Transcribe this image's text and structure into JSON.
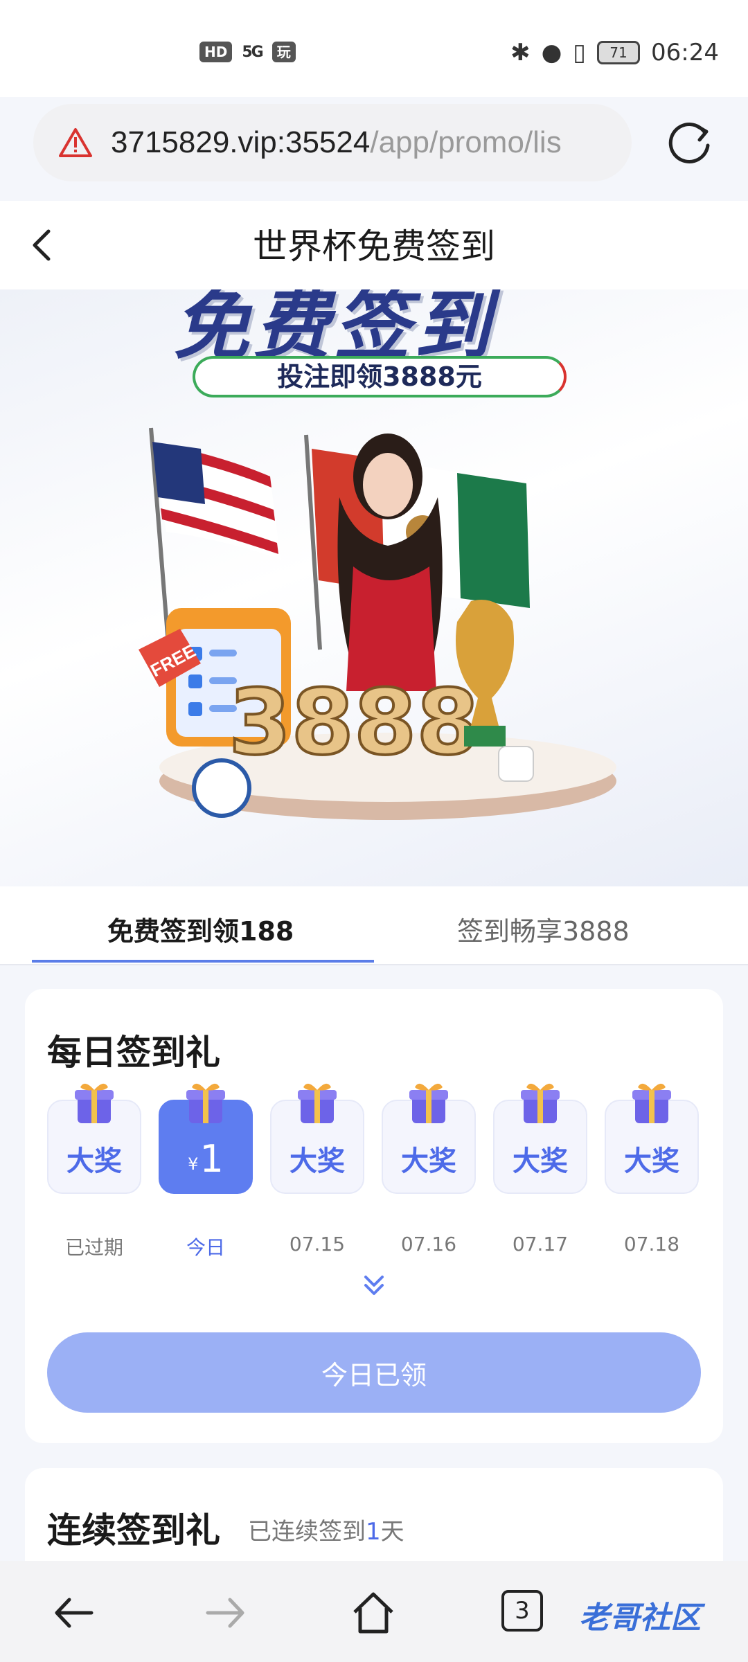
{
  "status_bar": {
    "hd": "HD",
    "network": "5G",
    "app_badge": "玩",
    "battery": "71",
    "time": "06:24"
  },
  "browser": {
    "url_host": "3715829.vip:35524",
    "url_path": "/app/promo/lis",
    "warning_icon": "warning-triangle-icon",
    "reload_icon": "reload-icon"
  },
  "header": {
    "title": "世界杯免费签到"
  },
  "banner": {
    "headline": "免费签到",
    "pill_text": "投注即领3888元",
    "free_tag": "FREE",
    "amount": "3888"
  },
  "tabs": [
    {
      "label": "免费签到领188",
      "active": true
    },
    {
      "label": "签到畅享3888",
      "active": false
    }
  ],
  "daily": {
    "title": "每日签到礼",
    "days": [
      {
        "value": "大奖",
        "label": "已过期"
      },
      {
        "currency": "¥",
        "value": "1",
        "label": "今日"
      },
      {
        "value": "大奖",
        "label": "07.15"
      },
      {
        "value": "大奖",
        "label": "07.16"
      },
      {
        "value": "大奖",
        "label": "07.17"
      },
      {
        "value": "大奖",
        "label": "07.18"
      }
    ],
    "button": "今日已领"
  },
  "streak": {
    "title": "连续签到礼",
    "prefix": "已连续签到",
    "count": "1",
    "suffix": "天"
  },
  "bottom_nav": {
    "tabs_count": "3",
    "watermark": "老哥社区"
  },
  "colors": {
    "accent": "#5e7df0",
    "button_disabled": "#9bb0f5",
    "warning": "#d9332f"
  }
}
